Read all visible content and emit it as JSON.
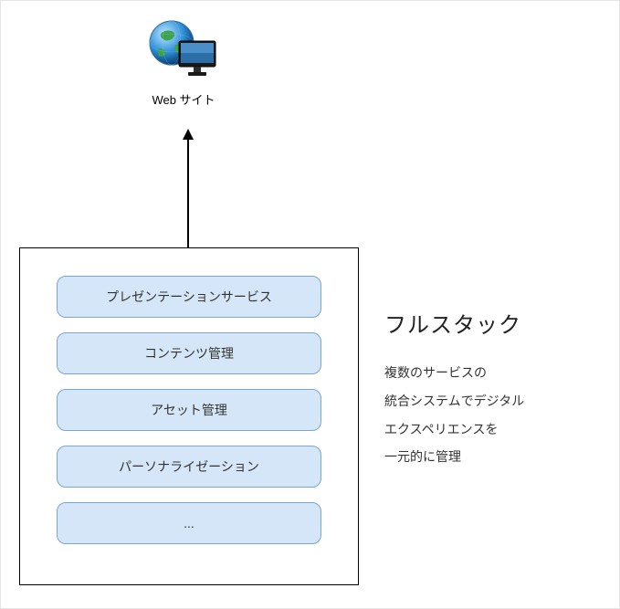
{
  "top": {
    "label": "Web サイト"
  },
  "stack": {
    "services": {
      "0": "プレゼンテーションサービス",
      "1": "コンテンツ管理",
      "2": "アセット管理",
      "3": "パーソナライゼーション",
      "4": "..."
    }
  },
  "side": {
    "title": "フルスタック",
    "desc_l1": "複数のサービスの",
    "desc_l2": "統合システムでデジタル",
    "desc_l3": "エクスペリエンスを",
    "desc_l4": "一元的に管理"
  }
}
